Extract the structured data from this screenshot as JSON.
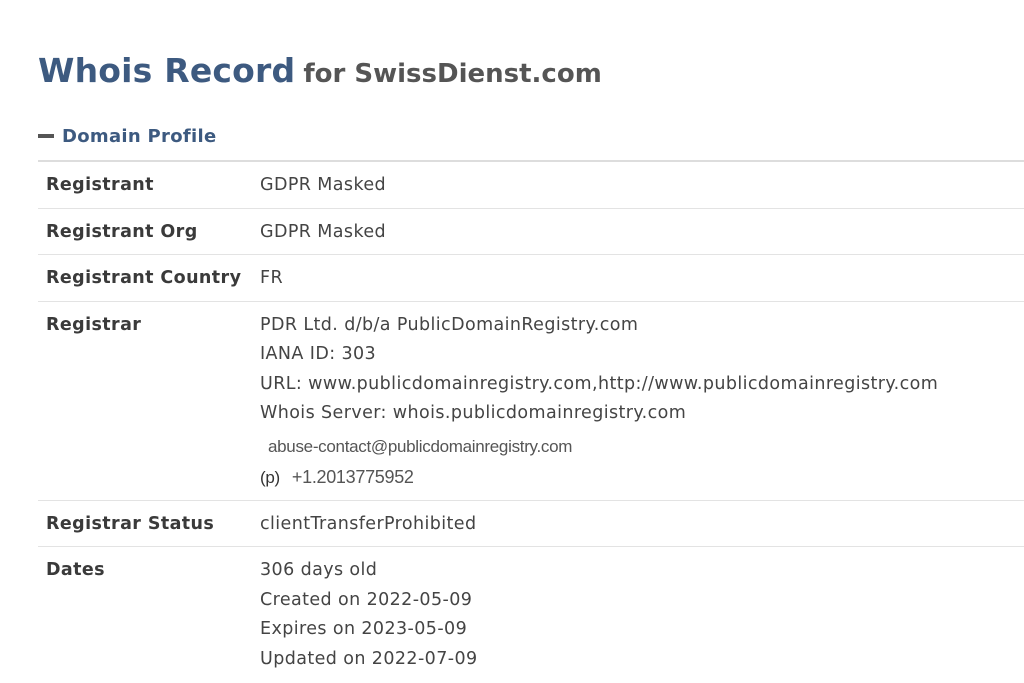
{
  "header": {
    "title_main": "Whois Record",
    "title_sub": "for SwissDienst.com"
  },
  "section": {
    "label": "Domain Profile",
    "icon": "minus-icon"
  },
  "rows": {
    "registrant": {
      "label": "Registrant",
      "value": "GDPR Masked"
    },
    "registrant_org": {
      "label": "Registrant Org",
      "value": "GDPR Masked"
    },
    "registrant_country": {
      "label": "Registrant Country",
      "value": "FR"
    },
    "registrar": {
      "label": "Registrar",
      "name": "PDR Ltd. d/b/a PublicDomainRegistry.com",
      "iana": "IANA ID: 303",
      "url": "URL: www.publicdomainregistry.com,http://www.publicdomainregistry.com",
      "whois_server": "Whois Server: whois.publicdomainregistry.com",
      "abuse_email": "abuse-contact@publicdomainregistry.com",
      "phone_prefix": "(p)",
      "phone": "+1.2013775952"
    },
    "registrar_status": {
      "label": "Registrar Status",
      "value": "clientTransferProhibited"
    },
    "dates": {
      "label": "Dates",
      "age": "306 days old",
      "created": "Created on 2022-05-09",
      "expires": "Expires on 2023-05-09",
      "updated": "Updated on 2022-07-09"
    }
  },
  "colors": {
    "title": "#3d5a80",
    "subtitle": "#555555",
    "divider": "#dddddd"
  }
}
